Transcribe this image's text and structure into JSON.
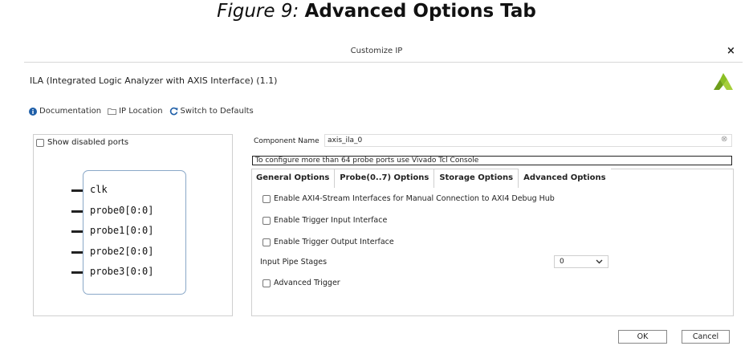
{
  "figure": {
    "label": "Figure 9:",
    "title": "Advanced Options Tab"
  },
  "dialog": {
    "title": "Customize IP",
    "close_label": "×",
    "ip_name": "ILA (Integrated Logic Analyzer with AXIS Interface) (1.1)"
  },
  "toolbar": {
    "documentation": "Documentation",
    "ip_location": "IP Location",
    "switch_defaults": "Switch to Defaults"
  },
  "left_panel": {
    "show_disabled_ports": "Show disabled ports",
    "ports": [
      "clk",
      "probe0[0:0]",
      "probe1[0:0]",
      "probe2[0:0]",
      "probe3[0:0]"
    ]
  },
  "component": {
    "label": "Component Name",
    "value": "axis_ila_0",
    "info": "To configure more than 64 probe ports use Vivado Tcl Console"
  },
  "tabs": [
    "General Options",
    "Probe(0..7) Options",
    "Storage Options",
    "Advanced Options"
  ],
  "options": {
    "axi4_stream": "Enable AXI4-Stream Interfaces for Manual Connection to AXI4 Debug Hub",
    "trigger_input": "Enable Trigger Input Interface",
    "trigger_output": "Enable Trigger Output Interface",
    "pipe_stages_label": "Input Pipe Stages",
    "pipe_stages_value": "0",
    "advanced_trigger": "Advanced Trigger"
  },
  "buttons": {
    "ok": "OK",
    "cancel": "Cancel"
  },
  "colors": {
    "logo_green": "#8bbf24",
    "info_icon": "#1f5fa8"
  }
}
